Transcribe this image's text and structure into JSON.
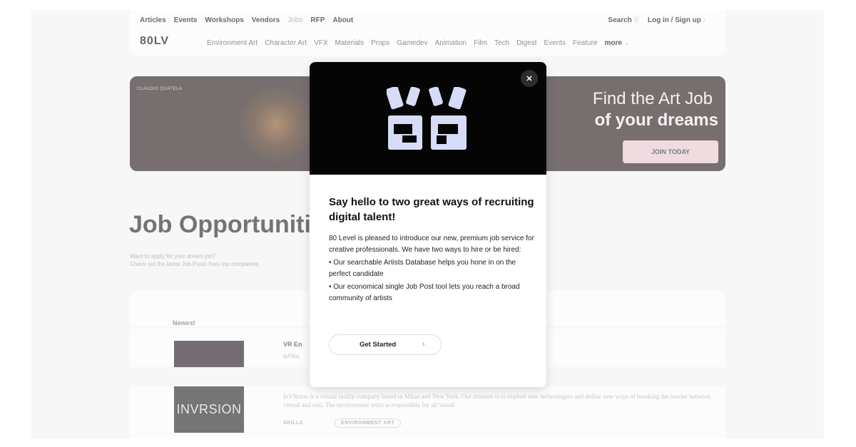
{
  "header": {
    "top_nav": [
      {
        "label": "Articles",
        "dim": false
      },
      {
        "label": "Events",
        "dim": false
      },
      {
        "label": "Workshops",
        "dim": false
      },
      {
        "label": "Vendors",
        "dim": false
      },
      {
        "label": "Jobs",
        "dim": true
      },
      {
        "label": "RFP",
        "dim": false
      },
      {
        "label": "About",
        "dim": false
      }
    ],
    "search_label": "Search",
    "login_label": "Log in / Sign up",
    "logo_text": "80LV",
    "categories": [
      "Environment Art",
      "Character Art",
      "VFX",
      "Materials",
      "Props",
      "Gamedev",
      "Animation",
      "Film",
      "Tech",
      "Digest",
      "Events",
      "Feature"
    ],
    "more_label": "more"
  },
  "banner": {
    "credit": "CLAUDIO QUATELA",
    "headline_1": "Find the Art Job",
    "headline_2": "of your dreams",
    "cta": "JOIN TODAY"
  },
  "jobs": {
    "title": "Job Opportuniti",
    "subtitle_1": "Want to apply for your dream job?",
    "subtitle_2": "Check out the latest Job Posts from top companies",
    "sort_label": "Newest",
    "row1_title": "VR En",
    "row1_sub": "inVRsi",
    "row2_logo": "INVRSION",
    "row2_desc": "InVRsion is a virtual reality company based in Milan and New York. Our mission is to explore new technologies and define new ways of breaking the barrier between virtual and real. The environment artist is responsible for all visual",
    "skills_label": "SKILLS",
    "skill_tag": "ENVIRONMENT ART"
  },
  "modal": {
    "title": "Say hello to two great ways of recruiting digital talent!",
    "intro": "80 Level is pleased to introduce our new, premium job service for creative professionals. We have two ways to hire or be hired:",
    "bullet_1": "• Our searchable Artists Database helps you hone in on the perfect candidate",
    "bullet_2": "• Our economical single Job Post tool lets you reach a broad community of artists",
    "cta": "Get Started",
    "close_symbol": "✕",
    "logo_color": "#d6dcf7",
    "header_bg": "#050505"
  }
}
